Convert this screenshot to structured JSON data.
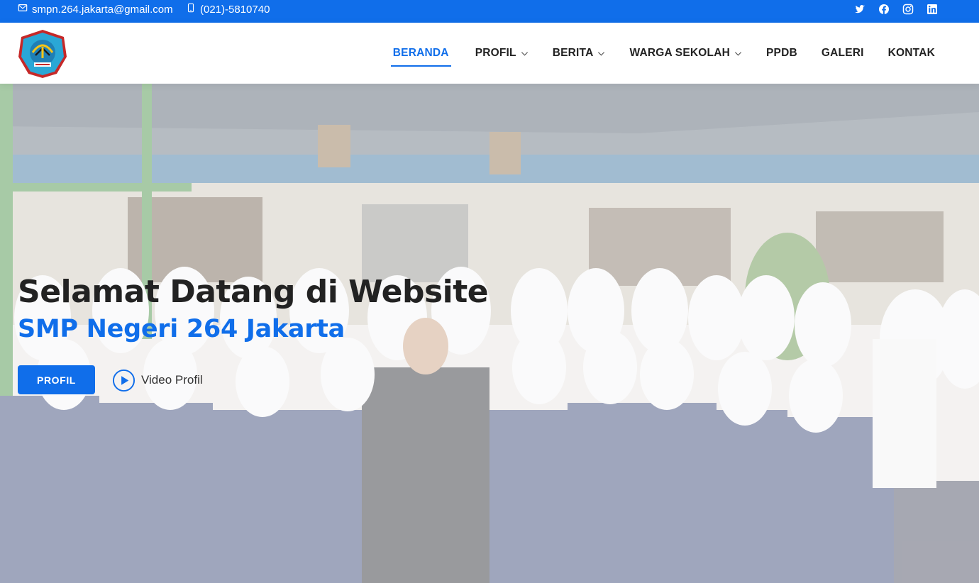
{
  "topbar": {
    "email": "smpn.264.jakarta@gmail.com",
    "phone": "(021)-5810740",
    "email_icon": "envelope-icon",
    "phone_icon": "phone-icon",
    "socials": [
      "twitter-icon",
      "facebook-icon",
      "instagram-icon",
      "linkedin-icon"
    ]
  },
  "header": {
    "logo": "school-emblem-logo",
    "nav": [
      {
        "label": "BERANDA",
        "active": true,
        "dropdown": false
      },
      {
        "label": "PROFIL",
        "active": false,
        "dropdown": true
      },
      {
        "label": "BERITA",
        "active": false,
        "dropdown": true
      },
      {
        "label": "WARGA SEKOLAH",
        "active": false,
        "dropdown": true
      },
      {
        "label": "PPDB",
        "active": false,
        "dropdown": false
      },
      {
        "label": "GALERI",
        "active": false,
        "dropdown": false
      },
      {
        "label": "KONTAK",
        "active": false,
        "dropdown": false
      }
    ]
  },
  "hero": {
    "title": "Selamat Datang di Website",
    "subtitle": "SMP Negeri 264 Jakarta",
    "button_label": "PROFIL",
    "video_label": "Video Profil",
    "background": "school-group-photo"
  },
  "colors": {
    "accent": "#106eea",
    "title": "#222222",
    "nav_text": "#222222"
  }
}
